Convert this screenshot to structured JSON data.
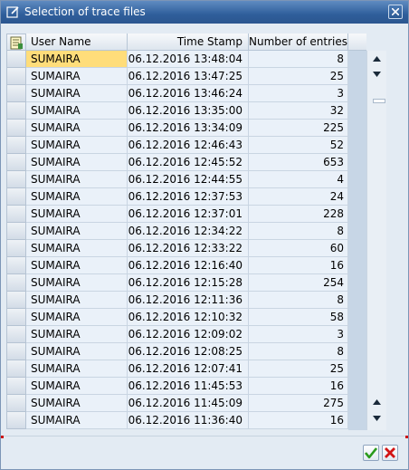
{
  "window": {
    "title": "Selection of trace files",
    "title_icon": "edit-window-icon",
    "close_icon": "close-icon"
  },
  "table": {
    "columns": [
      "User Name",
      "Time Stamp",
      "Number of entries"
    ],
    "rows": [
      {
        "user": "SUMAIRA",
        "timestamp": "06.12.2016 13:48:04",
        "entries": "8"
      },
      {
        "user": "SUMAIRA",
        "timestamp": "06.12.2016 13:47:25",
        "entries": "25"
      },
      {
        "user": "SUMAIRA",
        "timestamp": "06.12.2016 13:46:24",
        "entries": "3"
      },
      {
        "user": "SUMAIRA",
        "timestamp": "06.12.2016 13:35:00",
        "entries": "32"
      },
      {
        "user": "SUMAIRA",
        "timestamp": "06.12.2016 13:34:09",
        "entries": "225"
      },
      {
        "user": "SUMAIRA",
        "timestamp": "06.12.2016 12:46:43",
        "entries": "52"
      },
      {
        "user": "SUMAIRA",
        "timestamp": "06.12.2016 12:45:52",
        "entries": "653"
      },
      {
        "user": "SUMAIRA",
        "timestamp": "06.12.2016 12:44:55",
        "entries": "4"
      },
      {
        "user": "SUMAIRA",
        "timestamp": "06.12.2016 12:37:53",
        "entries": "24"
      },
      {
        "user": "SUMAIRA",
        "timestamp": "06.12.2016 12:37:01",
        "entries": "228"
      },
      {
        "user": "SUMAIRA",
        "timestamp": "06.12.2016 12:34:22",
        "entries": "8"
      },
      {
        "user": "SUMAIRA",
        "timestamp": "06.12.2016 12:33:22",
        "entries": "60"
      },
      {
        "user": "SUMAIRA",
        "timestamp": "06.12.2016 12:16:40",
        "entries": "16"
      },
      {
        "user": "SUMAIRA",
        "timestamp": "06.12.2016 12:15:28",
        "entries": "254"
      },
      {
        "user": "SUMAIRA",
        "timestamp": "06.12.2016 12:11:36",
        "entries": "8"
      },
      {
        "user": "SUMAIRA",
        "timestamp": "06.12.2016 12:10:32",
        "entries": "58"
      },
      {
        "user": "SUMAIRA",
        "timestamp": "06.12.2016 12:09:02",
        "entries": "3"
      },
      {
        "user": "SUMAIRA",
        "timestamp": "06.12.2016 12:08:25",
        "entries": "8"
      },
      {
        "user": "SUMAIRA",
        "timestamp": "06.12.2016 12:07:41",
        "entries": "25"
      },
      {
        "user": "SUMAIRA",
        "timestamp": "06.12.2016 11:45:53",
        "entries": "16"
      },
      {
        "user": "SUMAIRA",
        "timestamp": "06.12.2016 11:45:09",
        "entries": "275"
      },
      {
        "user": "SUMAIRA",
        "timestamp": "06.12.2016 11:36:40",
        "entries": "16"
      }
    ],
    "active_cell": {
      "row": 0,
      "column": "user"
    },
    "colors": {
      "active_cell": "#ffdd7a",
      "row_bg": "#eaf1f9",
      "titlebar": "#2f5e9b"
    }
  },
  "icons": {
    "header_corner": "column-settings-icon",
    "scroll_up": "scroll-up-icon",
    "scroll_down": "scroll-down-icon",
    "confirm": "checkmark-icon",
    "cancel": "cancel-x-icon"
  }
}
